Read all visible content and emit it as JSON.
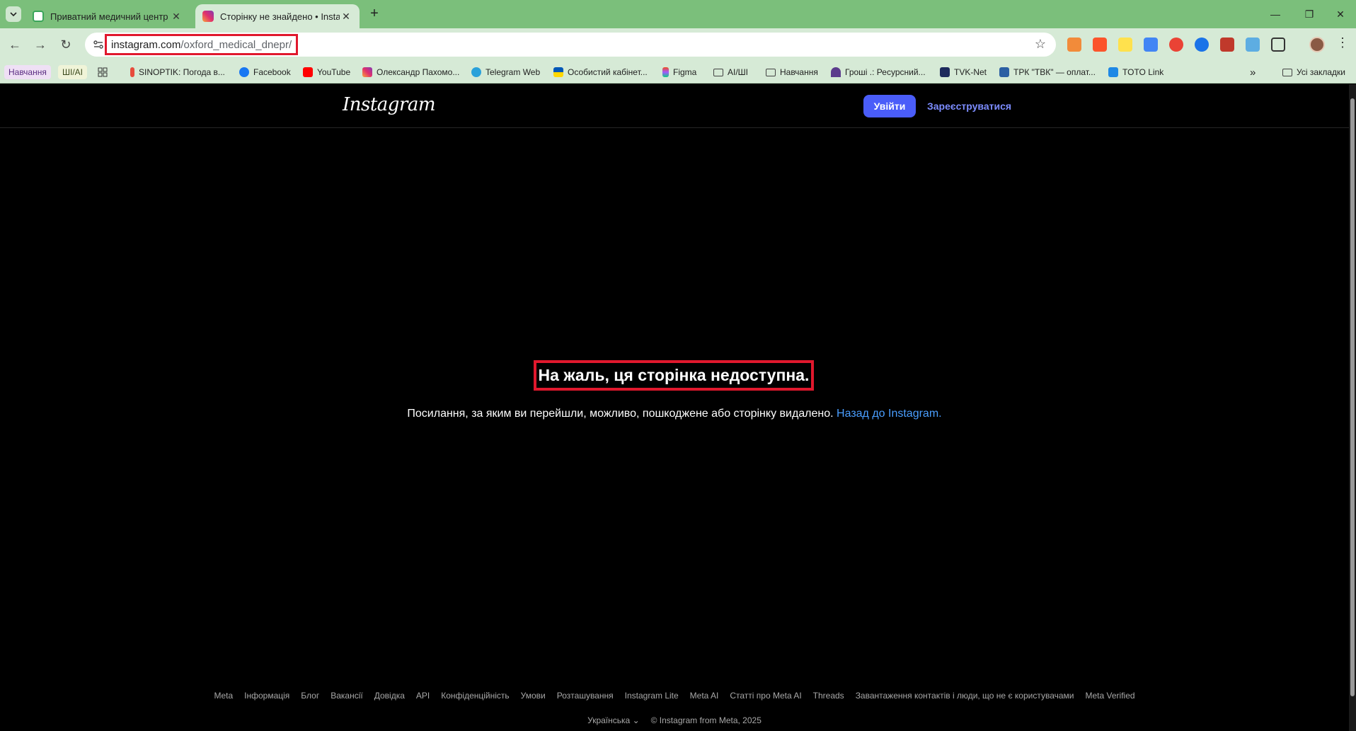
{
  "browser": {
    "tabs": [
      {
        "title": "Приватний медичний центр О",
        "active": false
      },
      {
        "title": "Сторінку не знайдено • Instagr",
        "active": true
      }
    ],
    "new_tab_label": "+",
    "window_controls": {
      "minimize": "—",
      "restore": "❐",
      "close": "✕"
    },
    "url": {
      "host": "instagram.com",
      "path": "/oxford_medical_dnepr/"
    },
    "bookmarks": [
      {
        "label": "Навчання",
        "type": "chip"
      },
      {
        "label": "ШІ/AI",
        "type": "chip"
      },
      {
        "label": "SINOPTIK: Погода в...",
        "type": "link"
      },
      {
        "label": "Facebook",
        "type": "link"
      },
      {
        "label": "YouTube",
        "type": "link"
      },
      {
        "label": "Олександр Пахомо...",
        "type": "link"
      },
      {
        "label": "Telegram Web",
        "type": "link"
      },
      {
        "label": "Особистий кабінет...",
        "type": "link"
      },
      {
        "label": "Figma",
        "type": "link"
      },
      {
        "label": "AI/ШІ",
        "type": "folder"
      },
      {
        "label": "Навчання",
        "type": "folder"
      },
      {
        "label": "Гроші .: Ресурсний...",
        "type": "link"
      },
      {
        "label": "TVK-Net",
        "type": "link"
      },
      {
        "label": "ТРК \"ТВК\" — оплат...",
        "type": "link"
      },
      {
        "label": "TOTO Link",
        "type": "link"
      }
    ],
    "all_bookmarks": "Усі закладки",
    "accent_colors": {
      "frame": "#7bbf7b",
      "toolbar": "#d6ead6",
      "highlight": "#e0182d"
    }
  },
  "instagram": {
    "logo": "Instagram",
    "login_label": "Увійти",
    "signup_label": "Зареєструватися",
    "error_title": "На жаль, ця сторінка недоступна.",
    "error_desc": "Посилання, за яким ви перейшли, можливо, пошкоджене або сторінку видалено.",
    "back_link": "Назад до Instagram.",
    "footer_links": [
      "Meta",
      "Інформація",
      "Блог",
      "Вакансії",
      "Довідка",
      "API",
      "Конфіденційність",
      "Умови",
      "Розташування",
      "Instagram Lite",
      "Meta AI",
      "Статті про Meta AI",
      "Threads",
      "Завантаження контактів і люди, що не є користувачами",
      "Meta Verified"
    ],
    "language": "Українська",
    "copyright": "© Instagram from Meta, 2025",
    "colors": {
      "login_button": "#4a5df9",
      "link": "#4a9eff"
    }
  }
}
